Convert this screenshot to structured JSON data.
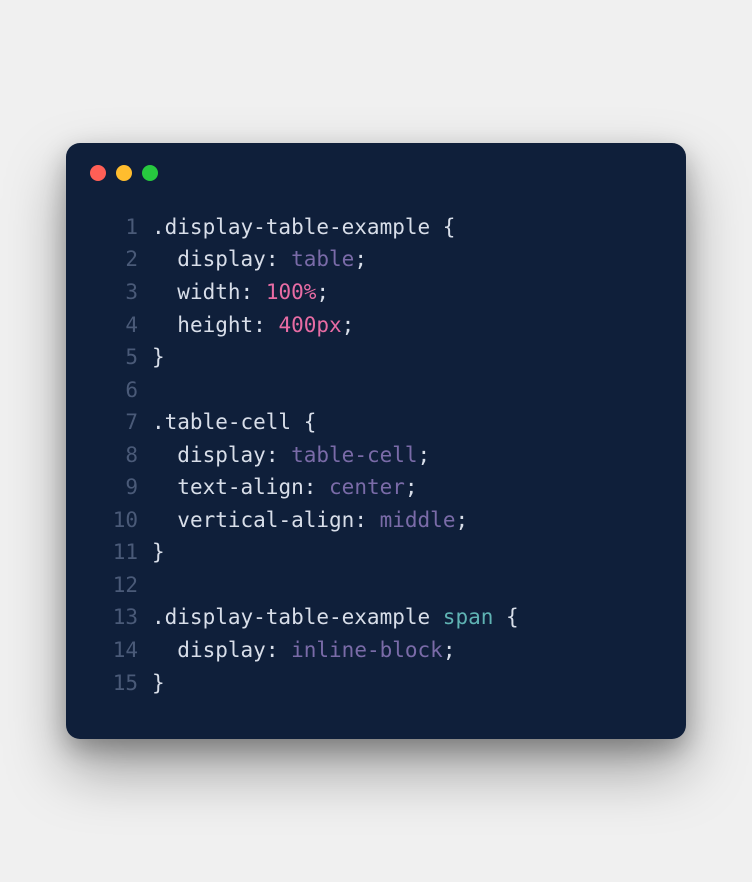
{
  "window": {
    "dots": [
      "red",
      "yellow",
      "green"
    ]
  },
  "code": {
    "lines": [
      {
        "num": "1",
        "tokens": [
          {
            "t": ".display-table-example ",
            "c": "selector"
          },
          {
            "t": "{",
            "c": "bracket"
          }
        ]
      },
      {
        "num": "2",
        "tokens": [
          {
            "t": "  ",
            "c": "punct"
          },
          {
            "t": "display",
            "c": "prop"
          },
          {
            "t": ": ",
            "c": "colon"
          },
          {
            "t": "table",
            "c": "kw"
          },
          {
            "t": ";",
            "c": "punct"
          }
        ]
      },
      {
        "num": "3",
        "tokens": [
          {
            "t": "  ",
            "c": "punct"
          },
          {
            "t": "width",
            "c": "prop"
          },
          {
            "t": ": ",
            "c": "colon"
          },
          {
            "t": "100%",
            "c": "num"
          },
          {
            "t": ";",
            "c": "punct"
          }
        ]
      },
      {
        "num": "4",
        "tokens": [
          {
            "t": "  ",
            "c": "punct"
          },
          {
            "t": "height",
            "c": "prop"
          },
          {
            "t": ": ",
            "c": "colon"
          },
          {
            "t": "400px",
            "c": "num"
          },
          {
            "t": ";",
            "c": "punct"
          }
        ]
      },
      {
        "num": "5",
        "tokens": [
          {
            "t": "}",
            "c": "bracket"
          }
        ]
      },
      {
        "num": "6",
        "tokens": []
      },
      {
        "num": "7",
        "tokens": [
          {
            "t": ".table-cell ",
            "c": "selector"
          },
          {
            "t": "{",
            "c": "bracket"
          }
        ]
      },
      {
        "num": "8",
        "tokens": [
          {
            "t": "  ",
            "c": "punct"
          },
          {
            "t": "display",
            "c": "prop"
          },
          {
            "t": ": ",
            "c": "colon"
          },
          {
            "t": "table-cell",
            "c": "kw"
          },
          {
            "t": ";",
            "c": "punct"
          }
        ]
      },
      {
        "num": "9",
        "tokens": [
          {
            "t": "  ",
            "c": "punct"
          },
          {
            "t": "text-align",
            "c": "prop"
          },
          {
            "t": ": ",
            "c": "colon"
          },
          {
            "t": "center",
            "c": "kw"
          },
          {
            "t": ";",
            "c": "punct"
          }
        ]
      },
      {
        "num": "10",
        "tokens": [
          {
            "t": "  ",
            "c": "punct"
          },
          {
            "t": "vertical-align",
            "c": "prop"
          },
          {
            "t": ": ",
            "c": "colon"
          },
          {
            "t": "middle",
            "c": "kw"
          },
          {
            "t": ";",
            "c": "punct"
          }
        ]
      },
      {
        "num": "11",
        "tokens": [
          {
            "t": "}",
            "c": "bracket"
          }
        ]
      },
      {
        "num": "12",
        "tokens": []
      },
      {
        "num": "13",
        "tokens": [
          {
            "t": ".display-table-example ",
            "c": "selector"
          },
          {
            "t": "span",
            "c": "tag"
          },
          {
            "t": " ",
            "c": "punct"
          },
          {
            "t": "{",
            "c": "bracket"
          }
        ]
      },
      {
        "num": "14",
        "tokens": [
          {
            "t": "  ",
            "c": "punct"
          },
          {
            "t": "display",
            "c": "prop"
          },
          {
            "t": ": ",
            "c": "colon"
          },
          {
            "t": "inline-block",
            "c": "kw"
          },
          {
            "t": ";",
            "c": "punct"
          }
        ]
      },
      {
        "num": "15",
        "tokens": [
          {
            "t": "}",
            "c": "bracket"
          }
        ]
      }
    ]
  }
}
